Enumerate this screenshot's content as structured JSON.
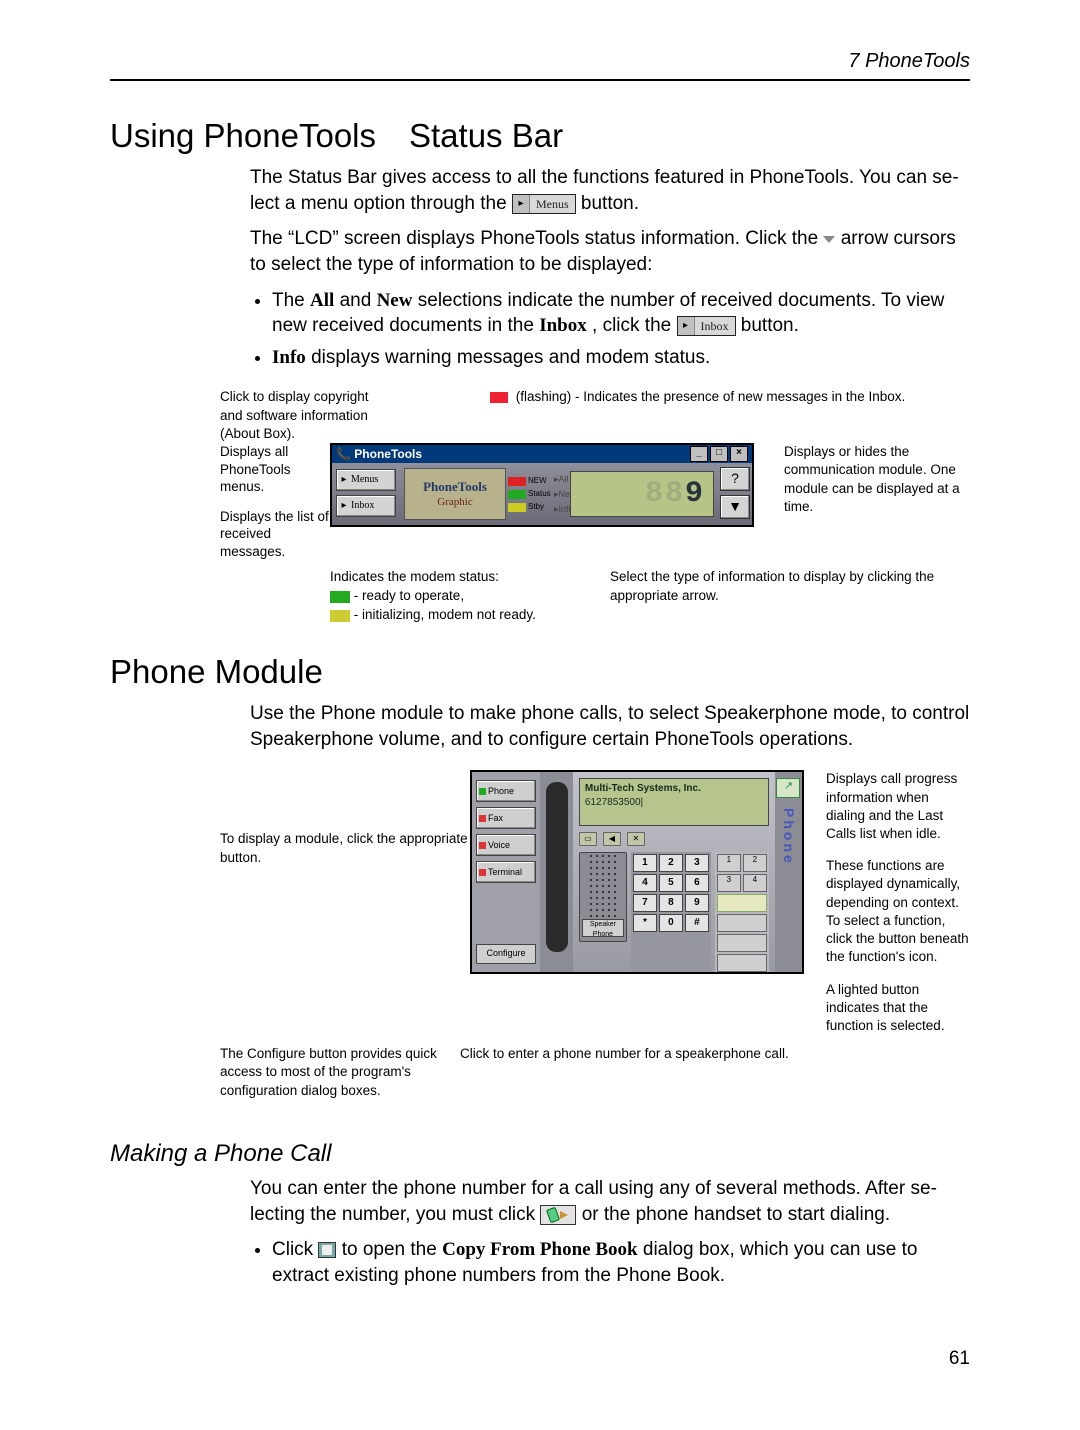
{
  "header": {
    "chapter": "7  PhoneTools"
  },
  "sec1": {
    "title": "Using PhoneTools Status Bar",
    "p1a": "The Status Bar gives access to all the functions featured in PhoneTools. You can se­lect a menu option through the ",
    "p1b": " button.",
    "menusInline": "Menus",
    "p2a": "The “LCD” screen displays PhoneTools status information. Click the",
    "p2b": " arrow cur­sors to select the type of information to be displayed:",
    "b1a": "The ",
    "b1b": "All",
    "b1c": " and ",
    "b1d": "New",
    "b1e": " selections indicate the number of received documents. To view new received documents in the ",
    "b1f": "Inbox",
    "b1g": ", click the ",
    "inboxInline": "Inbox",
    "b1h": " button.",
    "b2a": "Info",
    "b2b": " displays warning messages and modem status."
  },
  "fig1": {
    "topLeft": "Click to display copyright and software information (About Box).",
    "topMid": "(flashing) - Indicates the presence of new messages in the Inbox.",
    "topRightA": "Displays or hides the communication mod­ule. One module can be displayed at a time.",
    "leftA": "Displays all PhoneTools menus.",
    "leftB": "Displays the list of received messages.",
    "title": "PhoneTools",
    "btnMenus": "Menus",
    "btnInbox": "Inbox",
    "logoMain": "PhoneTools",
    "logoSub": "Graphic",
    "chipNew": "NEW",
    "chipStatus": "Status",
    "chipStby": "Stby",
    "listAll": "All",
    "listNew": "New",
    "listInfo": "Info",
    "lcdValue": "9",
    "bottomLeftA": "Indicates the modem status:",
    "bottomLeftB": " - ready to operate,",
    "bottomLeftC": " - initializing, modem not ready.",
    "bottomRight": "Select the type of information to display by clicking the appropri­ate arrow."
  },
  "sec2": {
    "title": "Phone Module",
    "p1": "Use the Phone module to make phone calls, to select Speakerphone mode, to control Speakerphone volume, and to configure certain PhoneTools operations."
  },
  "fig2": {
    "left": "To display a module, click the appropriate button.",
    "rightA": "Displays call progress infor­mation when dialing and the Last Calls list when idle.",
    "rightB": "These functions are displayed dynamically, depending on context. To select a function, click the button beneath the function's icon.",
    "rightC": "A lighted button indicates that the function is selected.",
    "tabs": {
      "phone": "Phone",
      "fax": "Fax",
      "voice": "Voice",
      "terminal": "Terminal",
      "configure": "Configure"
    },
    "displayTop": "Multi-Tech Systems, Inc.",
    "displayNum": "6127853500|",
    "speakerBtn": "Speaker Phone",
    "keypad": [
      "1",
      "2",
      "3",
      "4",
      "5",
      "6",
      "7",
      "8",
      "9",
      "*",
      "0",
      "#"
    ],
    "funcRow": [
      "1",
      "2",
      "3",
      "4"
    ],
    "sideWord": "Phone",
    "bottomLeft": "The Configure button provides quick access to most of the program's configuration dialog boxes.",
    "bottomRight": "Click to enter a phone number for a speaker­phone call."
  },
  "sec3": {
    "title": "Making a Phone Call",
    "p1a": "You can enter the phone number for a call using any of several methods. After se­lecting the number, you must click ",
    "p1b": " or the phone handset to start dialing.",
    "b1a": "Click ",
    "b1b": " to open the ",
    "b1c": "Copy From Phone Book",
    "b1d": " dialog box, which you can use to extract existing phone numbers from the Phone Book."
  },
  "pageNumber": "61"
}
